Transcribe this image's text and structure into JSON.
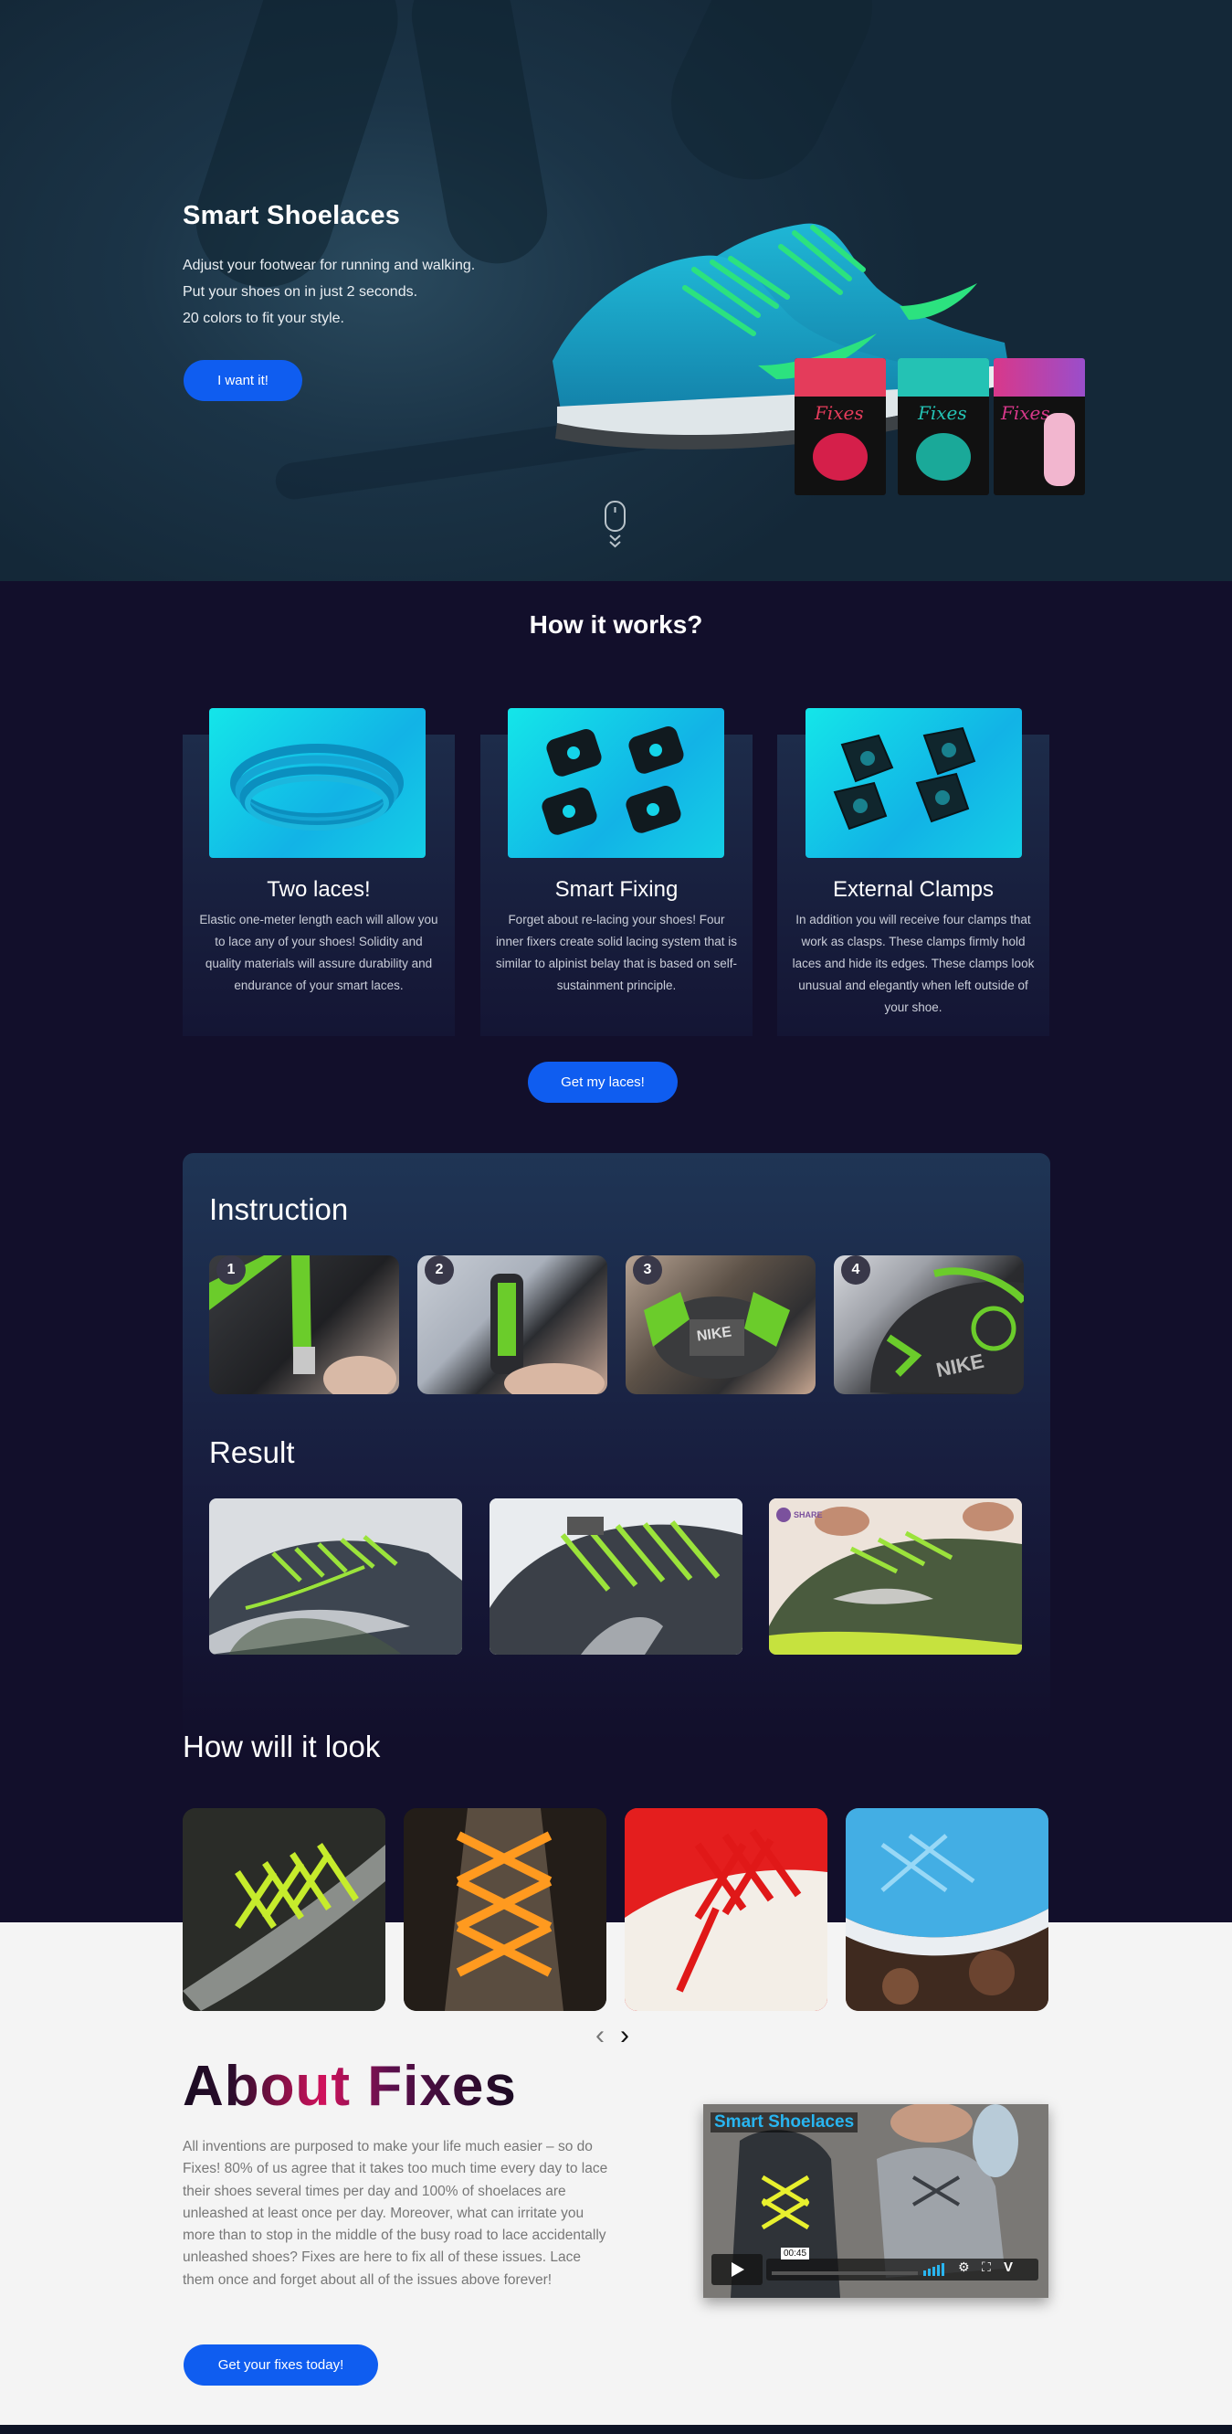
{
  "hero": {
    "title": "Smart Shoelaces",
    "lines": [
      "Adjust your footwear for running and walking.",
      "Put your shoes on in just 2 seconds.",
      "20 colors to fit your style."
    ],
    "cta_label": "I want it!",
    "packages": [
      {
        "brand": "Fixes",
        "color": "#e43c5b"
      },
      {
        "brand": "Fixes",
        "color": "#24c2b4"
      },
      {
        "brand": "Fixes",
        "color": "#d8388a"
      }
    ]
  },
  "how": {
    "title": "How it works?",
    "cards": [
      {
        "title": "Two laces!",
        "text": "Elastic one-meter length each will allow you to lace any of your shoes! Solidity and quality materials will assure durability and endurance of your smart laces."
      },
      {
        "title": "Smart Fixing",
        "text": "Forget about re-lacing your shoes! Four inner fixers create solid lacing system that is similar to alpinist belay that is based on self-sustainment principle."
      },
      {
        "title": "External Clamps",
        "text": "In addition you will receive four clamps that work as clasps. These clamps firmly hold laces and hide its edges. These clamps look unusual and elegantly when left outside of your shoe."
      }
    ],
    "cta_label": "Get my laces!"
  },
  "instruction": {
    "title": "Instruction",
    "steps": [
      "1",
      "2",
      "3",
      "4"
    ],
    "step_labels": [
      "",
      "",
      "NIKE",
      "NIKE"
    ]
  },
  "result": {
    "title": "Result",
    "share_label": "SHARE"
  },
  "look": {
    "title": "How will it look",
    "prev_icon": "‹",
    "next_icon": "›"
  },
  "about": {
    "title": "About Fixes",
    "text": "All inventions are purposed to make your life much easier – so do Fixes! 80% of us agree that it takes too much time every day to lace their shoes several times per day and 100% of shoelaces are unleashed at least once per day. Moreover, what can irritate you more than to stop in the middle of the busy road to lace accidentally unleashed shoes? Fixes are here to fix all of these issues. Lace them once and forget about all of the issues above forever!",
    "cta_label": "Get your fixes today!",
    "video": {
      "title": "Smart Shoelaces",
      "time": "00:45"
    }
  },
  "colors": {
    "accent": "#0f5df0",
    "dark_bg": "#120f2b",
    "card_cyan": "#14d4e8"
  }
}
